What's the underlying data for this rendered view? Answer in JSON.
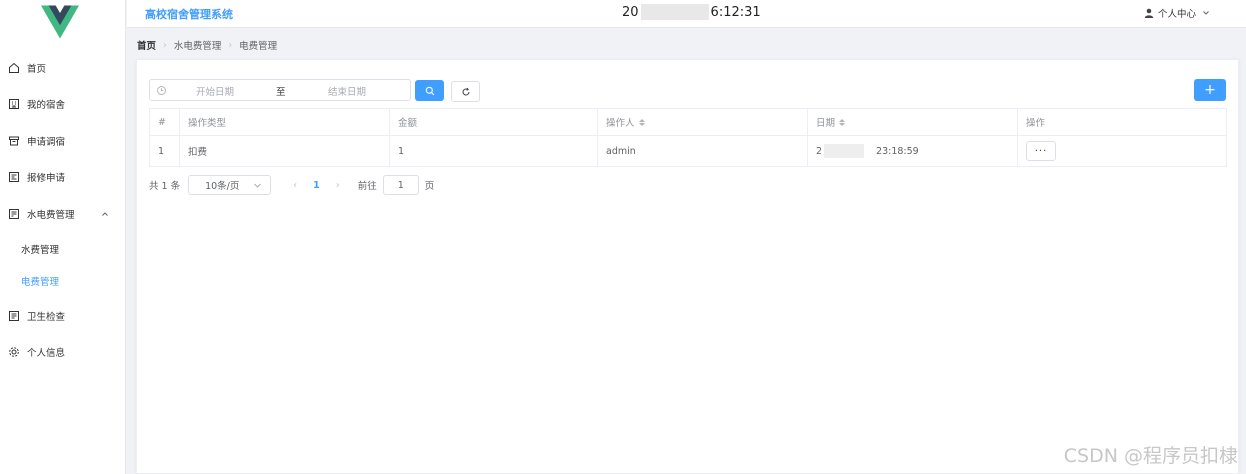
{
  "header": {
    "system_title": "高校宿舍管理系统",
    "clock_prefix": "20",
    "clock_suffix": "6:12:31",
    "user_menu_label": "个人中心"
  },
  "sidebar": {
    "items": [
      {
        "label": "首页",
        "icon": "home-icon"
      },
      {
        "label": "我的宿舍",
        "icon": "building-icon"
      },
      {
        "label": "申请调宿",
        "icon": "inbox-icon"
      },
      {
        "label": "报修申请",
        "icon": "wrench-doc-icon"
      },
      {
        "label": "水电费管理",
        "icon": "bill-icon"
      },
      {
        "label": "卫生检查",
        "icon": "checklist-icon"
      },
      {
        "label": "个人信息",
        "icon": "gear-icon"
      }
    ],
    "sub_items": [
      {
        "label": "水费管理",
        "active": false
      },
      {
        "label": "电费管理",
        "active": true
      }
    ]
  },
  "breadcrumb": {
    "home": "首页",
    "level1": "水电费管理",
    "level2": "电费管理"
  },
  "filters": {
    "start_placeholder": "开始日期",
    "range_separator": "至",
    "end_placeholder": "结束日期",
    "add_label": "+"
  },
  "table": {
    "columns": [
      "#",
      "操作类型",
      "金额",
      "操作人",
      "日期",
      "操作"
    ],
    "rows": [
      {
        "index": "1",
        "type": "扣费",
        "amount": "1",
        "operator": "admin",
        "date_prefix": "2",
        "date_suffix": "23:18:59",
        "action": "···"
      }
    ]
  },
  "pagination": {
    "total": "共 1 条",
    "page_size": "10条/页",
    "prev": "‹",
    "current": "1",
    "next": "›",
    "goto_label": "前往",
    "goto_value": "1",
    "page_unit": "页"
  },
  "watermark": "CSDN @程序员扣棣",
  "colors": {
    "accent": "#409eff",
    "logo_green": "#41b883",
    "logo_dark": "#35495e"
  }
}
